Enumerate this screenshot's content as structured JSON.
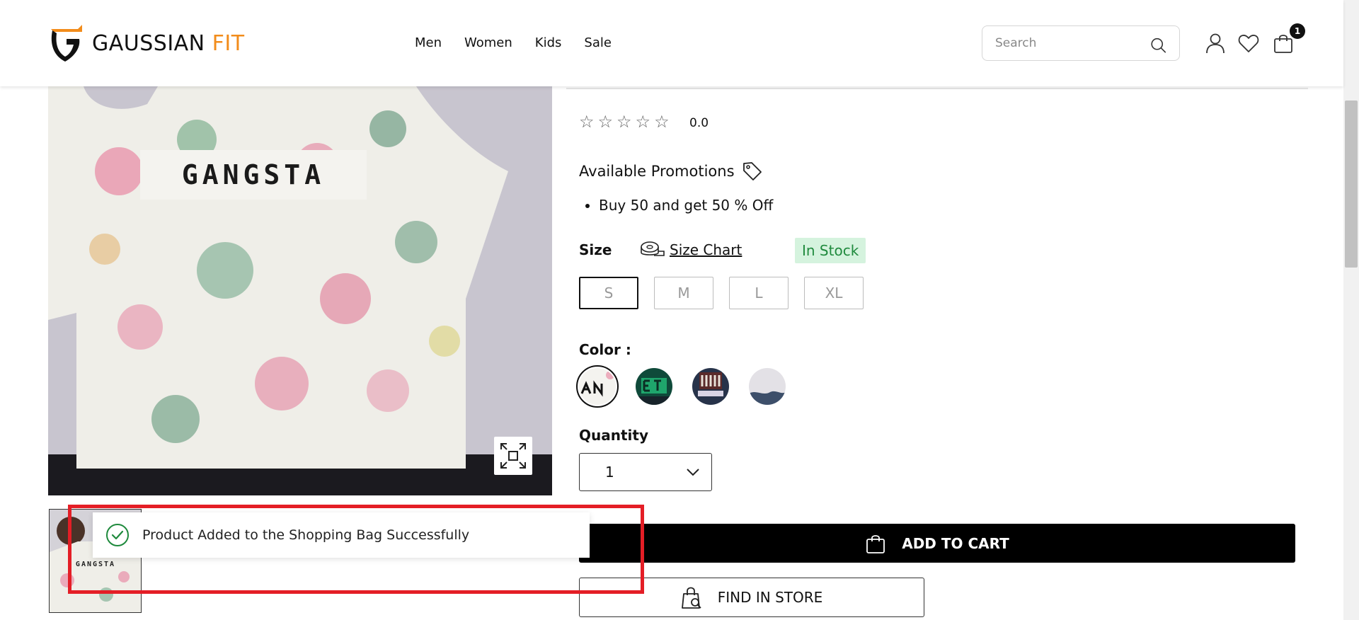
{
  "brand": {
    "name_primary": "GAUSSIAN",
    "name_accent": "FIT",
    "accent_color": "#f28c1b"
  },
  "nav": {
    "items": [
      "Men",
      "Women",
      "Kids",
      "Sale"
    ]
  },
  "search": {
    "placeholder": "Search",
    "icon": "search-icon"
  },
  "header_icons": {
    "account": "user-icon",
    "wishlist": "heart-icon",
    "cart": "shopping-bag-icon",
    "cart_count": "1"
  },
  "product": {
    "image_text": "GANGSTA",
    "thumbnail_text": "GANGSTA",
    "rating": {
      "value": "0.0",
      "stars": 5,
      "filled": 0
    },
    "promotions": {
      "title": "Available Promotions",
      "items": [
        "Buy 50 and get 50 % Off"
      ]
    },
    "size": {
      "label": "Size",
      "chart_label": "Size Chart",
      "stock_status": "In Stock",
      "stock_color": "#1f8a3d",
      "options": [
        "S",
        "M",
        "L",
        "XL"
      ],
      "selected": "S"
    },
    "color": {
      "label": "Color :",
      "selected_index": 0
    },
    "quantity": {
      "label": "Quantity",
      "value": "1"
    },
    "buttons": {
      "add_to_cart": "ADD TO CART",
      "find_in_store": "FIND IN STORE"
    }
  },
  "toast": {
    "message": "Product Added to the Shopping Bag Successfully",
    "status_color": "#1f8a3d"
  }
}
